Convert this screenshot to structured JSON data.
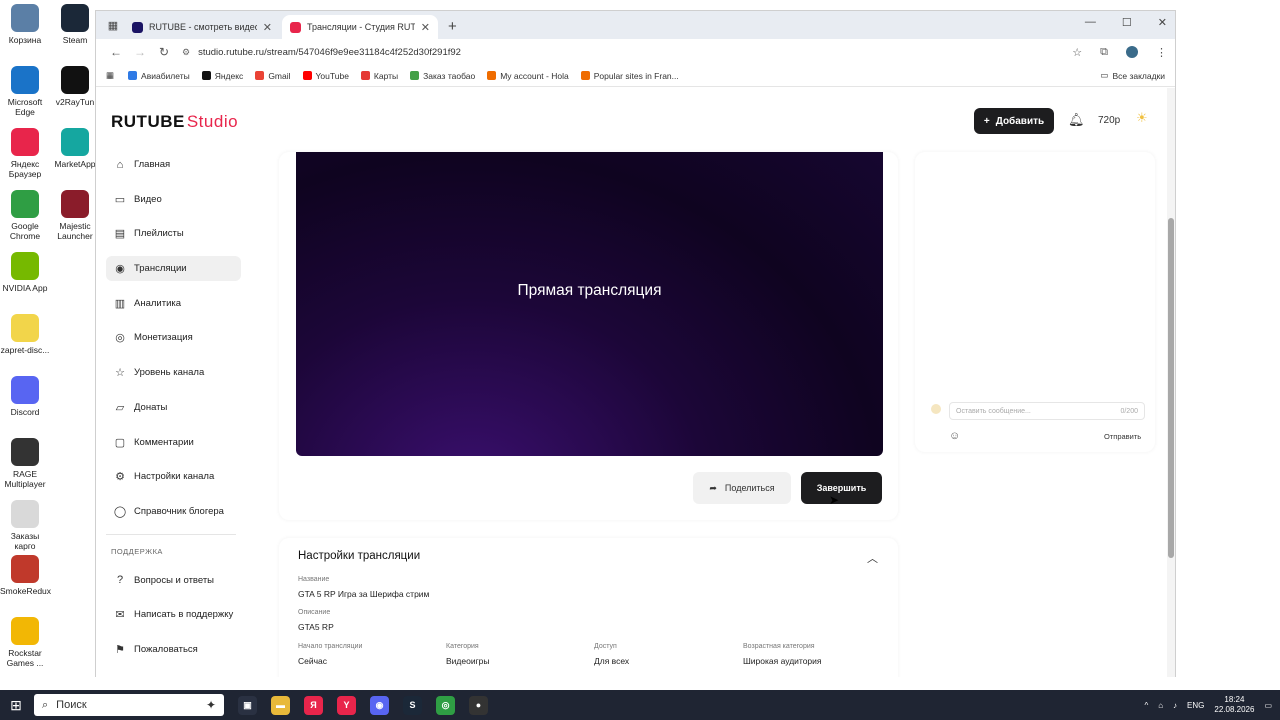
{
  "desktop_icons": [
    {
      "label": "Корзина",
      "icon": "trash-icon",
      "color": "#5b7fa6"
    },
    {
      "label": "Steam",
      "icon": "steam-icon",
      "color": "#1b2838"
    },
    {
      "label": "Microsoft Edge",
      "icon": "edge-icon",
      "color": "#1a73c8"
    },
    {
      "label": "v2RayTun",
      "icon": "v2raytun-icon",
      "color": "#111111"
    },
    {
      "label": "Яндекс Браузер",
      "icon": "yandex-browser-icon",
      "color": "#e8254b"
    },
    {
      "label": "MarketApp",
      "icon": "marketapp-icon",
      "color": "#15a7a0"
    },
    {
      "label": "Google Chrome",
      "icon": "chrome-icon",
      "color": "#2f9e44"
    },
    {
      "label": "Majestic Launcher",
      "icon": "majestic-icon",
      "color": "#8a1c2a"
    },
    {
      "label": "NVIDIA App",
      "icon": "nvidia-icon",
      "color": "#76b900"
    },
    {
      "label": "zapret-disc...",
      "icon": "file-icon",
      "color": "#f2d54a"
    },
    {
      "label": "Discord",
      "icon": "discord-icon",
      "color": "#5865f2"
    },
    {
      "label": "RAGE Multiplayer",
      "icon": "rage-icon",
      "color": "#333333"
    },
    {
      "label": "Заказы карго",
      "icon": "file-icon",
      "color": "#d9d9d9"
    },
    {
      "label": "SmokeRedux",
      "icon": "smokeredux-icon",
      "color": "#c0392b"
    },
    {
      "label": "Rockstar Games ...",
      "icon": "rockstar-icon",
      "color": "#f2b705"
    }
  ],
  "browser": {
    "tabs": [
      {
        "title": "RUTUBE - смотреть видео онлайн",
        "close": "✕",
        "color": "#1b1464",
        "active": false
      },
      {
        "title": "Трансляции - Студия RUTUBE",
        "close": "✕",
        "color": "#e8254b",
        "active": true
      }
    ],
    "new_tab": "+",
    "url": "studio.rutube.ru/stream/547046f9e9ee31184c4f252d30f291f92",
    "bookmarks": [
      {
        "label": "Авиабилеты",
        "color": "#2f7ae5"
      },
      {
        "label": "Яндекс",
        "color": "#111111"
      },
      {
        "label": "Gmail",
        "color": "#ea4335"
      },
      {
        "label": "YouTube",
        "color": "#ff0000"
      },
      {
        "label": "Карты",
        "color": "#e53935"
      },
      {
        "label": "Заказ таобао",
        "color": "#43a047"
      },
      {
        "label": "My account - Hola",
        "color": "#ef6c00"
      },
      {
        "label": "Popular sites in Fran...",
        "color": "#ef6c00"
      }
    ],
    "all_bookmarks": "Все закладки"
  },
  "studio": {
    "logo": "RUTUBE",
    "logo_suffix": "Studio",
    "add_button": "Добавить",
    "quality": "720p",
    "sidebar": [
      {
        "label": "Главная",
        "icon": "home-icon",
        "glyph": "⌂",
        "active": false
      },
      {
        "label": "Видео",
        "icon": "video-icon",
        "glyph": "▭",
        "active": false
      },
      {
        "label": "Плейлисты",
        "icon": "playlist-icon",
        "glyph": "▤",
        "active": false
      },
      {
        "label": "Трансляции",
        "icon": "broadcast-icon",
        "glyph": "◉",
        "active": true
      },
      {
        "label": "Аналитика",
        "icon": "analytics-icon",
        "glyph": "▥",
        "active": false
      },
      {
        "label": "Монетизация",
        "icon": "monetization-icon",
        "glyph": "◎",
        "active": false
      },
      {
        "label": "Уровень канала",
        "icon": "level-icon",
        "glyph": "☆",
        "active": false
      },
      {
        "label": "Донаты",
        "icon": "donate-icon",
        "glyph": "▱",
        "active": false
      },
      {
        "label": "Комментарии",
        "icon": "comments-icon",
        "glyph": "▢",
        "active": false
      },
      {
        "label": "Настройки канала",
        "icon": "settings-icon",
        "glyph": "⚙",
        "active": false
      },
      {
        "label": "Справочник блогера",
        "icon": "guide-icon",
        "glyph": "◯",
        "active": false
      }
    ],
    "support_heading": "ПОДДЕРЖКА",
    "support": [
      {
        "label": "Вопросы и ответы",
        "icon": "faq-icon",
        "glyph": "?"
      },
      {
        "label": "Написать в поддержку",
        "icon": "mail-icon",
        "glyph": "✉"
      },
      {
        "label": "Пожаловаться",
        "icon": "flag-icon",
        "glyph": "⚑"
      }
    ],
    "video_title": "Прямая трансляция",
    "share_button": "Поделиться",
    "end_button": "Завершить",
    "chat": {
      "placeholder": "Оставить сообщение...",
      "counter": "0/200",
      "send": "Отправить"
    },
    "settings": {
      "title": "Настройки трансляции",
      "name_label": "Название",
      "name_value": "GTA 5 RP Игра за Шерифа стрим",
      "desc_label": "Описание",
      "desc_value": "GTA5 RP",
      "start_label": "Начало трансляции",
      "start_value": "Сейчас",
      "category_label": "Категория",
      "category_value": "Видеоигры",
      "access_label": "Доступ",
      "access_value": "Для всех",
      "age_label": "Возрастная категория",
      "age_value": "Широкая аудитория"
    }
  },
  "taskbar": {
    "search_placeholder": "Поиск",
    "lang": "ENG",
    "time": "18:24",
    "date": "22.08.2026"
  }
}
